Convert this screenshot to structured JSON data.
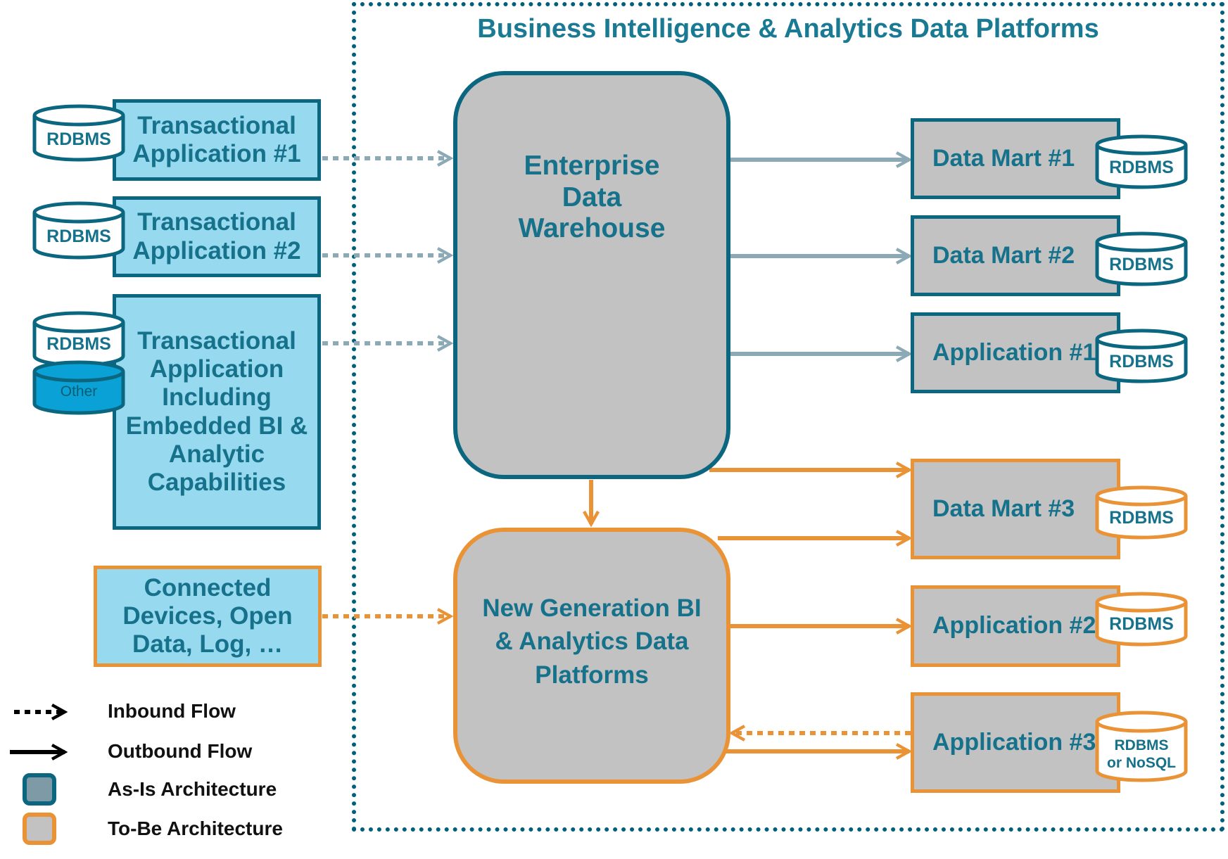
{
  "colors": {
    "as_is": "#0b6680",
    "to_be": "#ea9336",
    "source_fill": "#97d9ef",
    "platform_fill": "#c2c2c2",
    "text": "#16718b",
    "inbound_gray": "#8ca9b6",
    "outbound_gray": "#8ca9b6",
    "other_fill": "#0aa2d6"
  },
  "header": {
    "title": "Business Intelligence & Analytics Data Platforms"
  },
  "sources": {
    "tx1": {
      "label": "Transactional Application #1",
      "db": "RDBMS"
    },
    "tx2": {
      "label": "Transactional Application #2",
      "db": "RDBMS"
    },
    "tx3": {
      "label": "Transactional Application Including Embedded BI & Analytic Capabilities",
      "db": "RDBMS",
      "db2": "Other"
    },
    "devices": {
      "label": "Connected Devices, Open Data, Log, …"
    }
  },
  "platforms": {
    "edw": {
      "label": "Enterprise Data Warehouse"
    },
    "ngen": {
      "label": "New Generation BI & Analytics Data Platforms"
    }
  },
  "targets": {
    "dm1": {
      "label": "Data Mart #1",
      "db": "RDBMS"
    },
    "dm2": {
      "label": "Data Mart #2",
      "db": "RDBMS"
    },
    "app1": {
      "label": "Application #1",
      "db": "RDBMS"
    },
    "dm3": {
      "label": "Data Mart #3",
      "db": "RDBMS"
    },
    "app2": {
      "label": "Application #2",
      "db": "RDBMS"
    },
    "app3": {
      "label": "Application #3",
      "db_line1": "RDBMS",
      "db_line2": "or NoSQL"
    }
  },
  "legend": {
    "inbound": "Inbound Flow",
    "outbound": "Outbound Flow",
    "as_is": "As-Is Architecture",
    "to_be": "To-Be Architecture"
  }
}
